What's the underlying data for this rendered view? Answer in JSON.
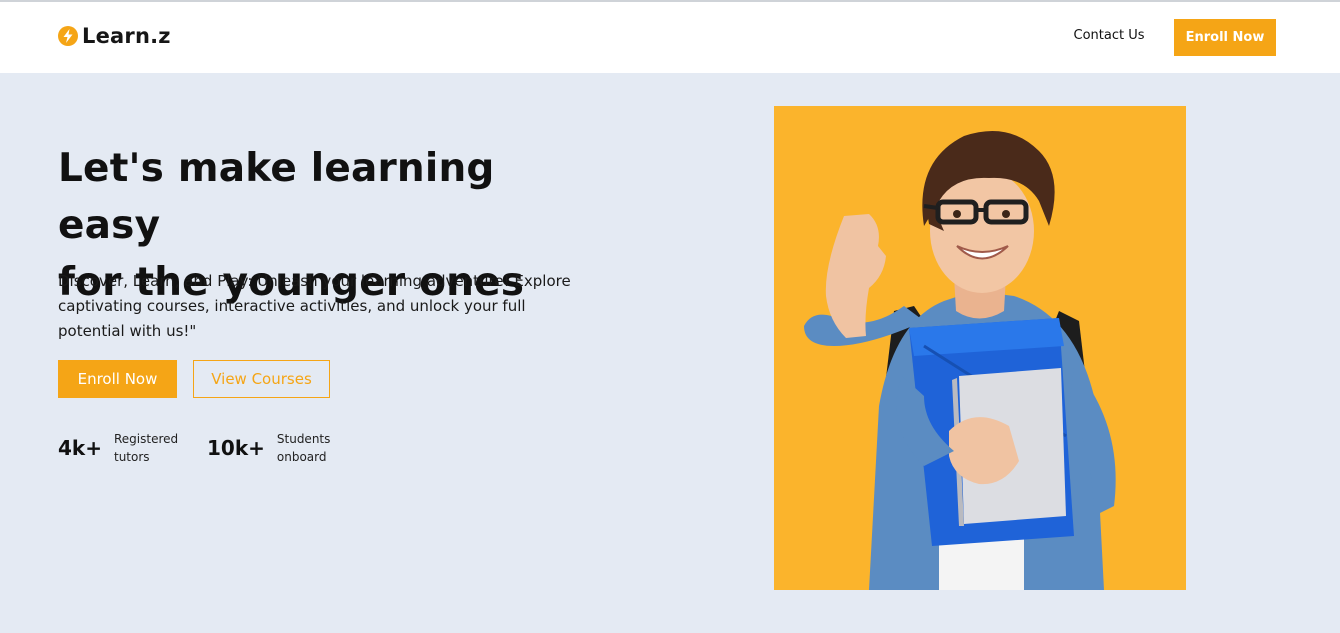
{
  "brand": {
    "name": "Learn.z",
    "icon": "lightning-bolt-icon",
    "accent_color": "#f5a516"
  },
  "nav": {
    "contact_label": "Contact Us",
    "enroll_label": "Enroll Now"
  },
  "hero": {
    "title_line1": "Let's make learning easy",
    "title_line2": "for the younger ones",
    "description": "Discover, Learn, and Play: Unleash your learning adventure! Explore captivating courses, interactive activities, and unlock your full potential with us!\"",
    "primary_button": "Enroll Now",
    "secondary_button": "View Courses",
    "stats": [
      {
        "value": "4k+",
        "label_line1": "Registered",
        "label_line2": "tutors"
      },
      {
        "value": "10k+",
        "label_line1": "Students",
        "label_line2": "onboard"
      }
    ],
    "photo": {
      "background_color": "#fbb42c"
    }
  }
}
